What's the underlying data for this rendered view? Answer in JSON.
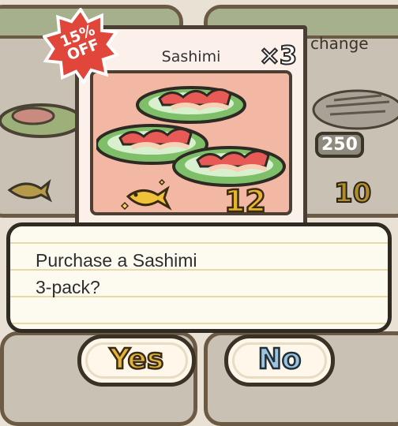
{
  "background": {
    "right_card_label": "change",
    "left_price": "",
    "right_price": "10",
    "right_badge": "250"
  },
  "item": {
    "title": "Sashimi",
    "quantity": "×3",
    "price": "12",
    "discount": "15% OFF"
  },
  "dialog": {
    "line1": "Purchase a Sashimi",
    "line2": "3-pack?"
  },
  "buttons": {
    "yes": "Yes",
    "no": "No"
  },
  "colors": {
    "card_bg": "#fbf1ea",
    "inner_bg": "#f3b8a4",
    "badge_red": "#e0473a",
    "gold": "#e8b42a",
    "blue": "#9ec3df"
  }
}
